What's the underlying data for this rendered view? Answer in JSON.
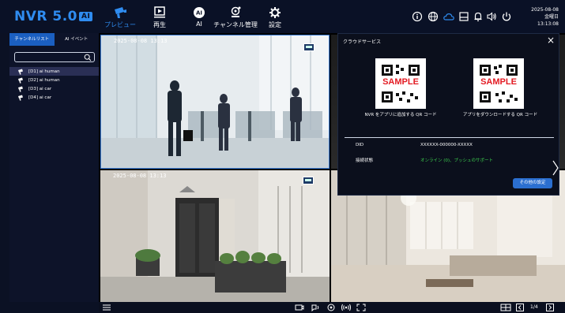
{
  "app": {
    "name": "NVR 5.0",
    "badge": "AI"
  },
  "nav": [
    {
      "label": "プレビュー",
      "icon": "preview-icon",
      "active": true
    },
    {
      "label": "再生",
      "icon": "playback-icon",
      "active": false
    },
    {
      "label": "AI",
      "icon": "ai-icon",
      "active": false
    },
    {
      "label": "チャンネル管理",
      "icon": "camera-manage-icon",
      "active": false
    },
    {
      "label": "設定",
      "icon": "settings-gear-icon",
      "active": false
    }
  ],
  "clock": {
    "date": "2025-08-08",
    "weekday": "金曜日",
    "time": "13:13:08"
  },
  "left_panel": {
    "tabs": [
      "チャンネルリスト",
      "AI イベント"
    ],
    "search_placeholder": "",
    "channels": [
      {
        "label": "[D1] ai human",
        "selected": true
      },
      {
        "label": "[D2] ai human",
        "selected": false
      },
      {
        "label": "[D3] ai car",
        "selected": false
      },
      {
        "label": "[D4] ai car",
        "selected": false
      }
    ]
  },
  "cameras": [
    {
      "timestamp": "2025-08-08 13:13"
    },
    {
      "timestamp": "2025-08-08 13:13"
    }
  ],
  "cloud": {
    "title": "クラウドサービス",
    "qr_sample_text": "SAMPLE",
    "qr1_caption": "NVR をアプリに追加する QR コード",
    "qr2_caption": "アプリをダウンロードする QR コード",
    "did_label": "DID",
    "did_value": "XXXXXX-000000-XXXXX",
    "status_label": "接続状態",
    "status_value": "オンライン (0)、プッシュのサポート",
    "button": "その他の設定",
    "status_color": "#3ccf4e"
  },
  "bottom": {
    "page": "1/4"
  },
  "colors": {
    "accent": "#2f8cf0",
    "tab_active": "#1b5fc1",
    "button": "#2b6fd0"
  }
}
